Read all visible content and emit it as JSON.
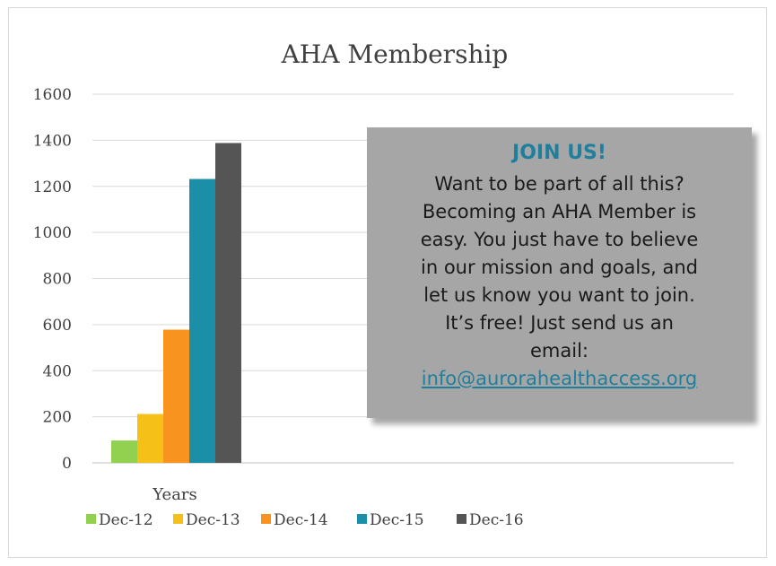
{
  "chart_data": {
    "type": "bar",
    "title": "AHA Membership",
    "categories": [
      "Years"
    ],
    "series": [
      {
        "name": "Dec-12",
        "values": [
          97
        ],
        "color": "#92d050"
      },
      {
        "name": "Dec-13",
        "values": [
          212
        ],
        "color": "#f5c018"
      },
      {
        "name": "Dec-14",
        "values": [
          578
        ],
        "color": "#f7931e"
      },
      {
        "name": "Dec-15",
        "values": [
          1232
        ],
        "color": "#1b8fa8"
      },
      {
        "name": "Dec-16",
        "values": [
          1388
        ],
        "color": "#555555"
      }
    ],
    "y_ticks": [
      "0",
      "200",
      "400",
      "600",
      "800",
      "1000",
      "1200",
      "1400",
      "1600"
    ],
    "ylim": [
      0,
      1600
    ],
    "grid": true,
    "legend": "bottom"
  },
  "callout": {
    "heading": "JOIN US!",
    "lines": [
      "Want to be part of all this?",
      "Becoming an AHA Member is",
      "easy.  You just have to believe",
      "in our mission and goals, and",
      "let us know you want to join.",
      "It’s free!  Just send us an",
      "email:"
    ],
    "email": "info@aurorahealthaccess.org",
    "colors": {
      "background": "#a6a6a6",
      "accent": "#1f7f9c"
    }
  }
}
